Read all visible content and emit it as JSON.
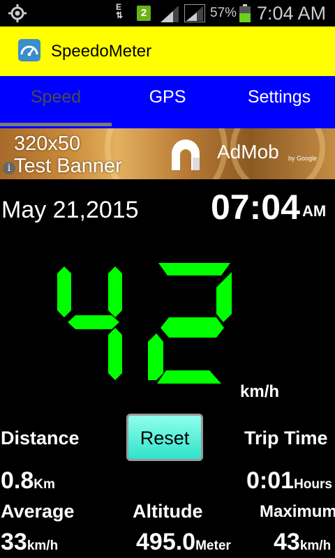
{
  "status_bar": {
    "network_type": "E",
    "notification_count": "2",
    "battery_percent": "57%",
    "time": "7:04 AM",
    "icons": [
      "gps-icon",
      "data-arrows-icon",
      "notification-badge-icon",
      "signal-icon",
      "signal-icon",
      "battery-icon"
    ]
  },
  "app": {
    "title": "SpeedoMeter",
    "icon": "speedometer-icon"
  },
  "tabs": [
    {
      "label": "Speed",
      "active": true
    },
    {
      "label": "GPS",
      "active": false
    },
    {
      "label": "Settings",
      "active": false
    }
  ],
  "ad": {
    "line1": "320x50",
    "line2": "Test Banner",
    "brand": "AdMob",
    "by": "by Google",
    "info": "i"
  },
  "clock": {
    "date": "May 21,2015",
    "time": "07:04",
    "ampm": "AM"
  },
  "speed": {
    "value": "42",
    "unit": "km/h",
    "digit_color": "#00ff00"
  },
  "stats": {
    "distance": {
      "label": "Distance",
      "value": "0.8",
      "unit": "Km"
    },
    "reset_label": "Reset",
    "trip_time": {
      "label": "Trip Time",
      "value": "0:01",
      "unit": "Hours"
    },
    "average": {
      "label": "Average",
      "value": "33",
      "unit": "km/h"
    },
    "altitude": {
      "label": "Altitude",
      "value": "495.0",
      "unit": "Meter"
    },
    "maximum": {
      "label": "Maximum",
      "value": "43",
      "unit": "km/h"
    }
  },
  "colors": {
    "action_bar": "#ffff00",
    "tab_bar": "#0000ff",
    "background": "#000000",
    "reset_button": "#40ecd2"
  }
}
